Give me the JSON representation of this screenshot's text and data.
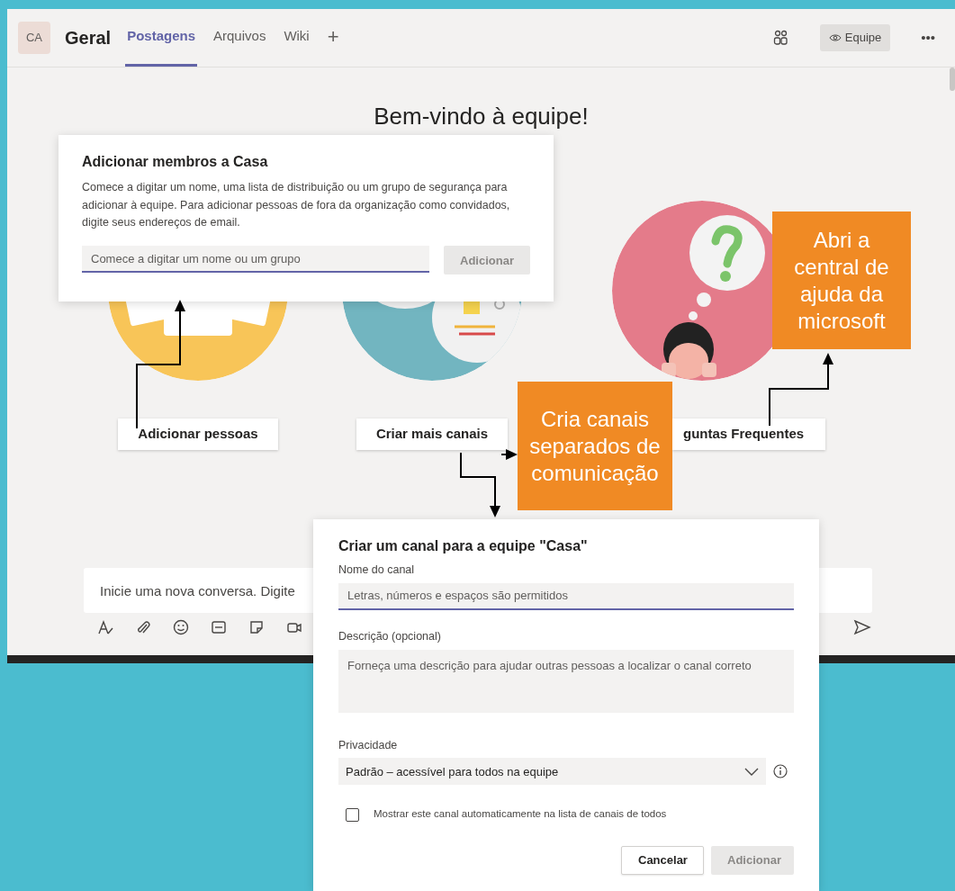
{
  "header": {
    "avatar": "CA",
    "channel": "Geral",
    "add_tab": "+",
    "team_button": "Equipe",
    "more": "•••",
    "tabs": [
      {
        "label": "Postagens",
        "selected": true
      },
      {
        "label": "Arquivos",
        "selected": false
      },
      {
        "label": "Wiki",
        "selected": false
      }
    ]
  },
  "welcome": {
    "title": "Bem-vindo à equipe!",
    "actions": [
      {
        "kind": "people",
        "label": "Adicionar pessoas"
      },
      {
        "kind": "channels",
        "label": "Criar mais canais"
      },
      {
        "kind": "faq",
        "label": "guntas Frequentes"
      }
    ]
  },
  "compose": {
    "placeholder": "Inicie uma nova conversa. Digite"
  },
  "add_members_dialog": {
    "title": "Adicionar membros a Casa",
    "description": "Comece a digitar um nome, uma lista de distribuição ou um grupo de segurança para adicionar à equipe. Para adicionar pessoas de fora da organização como convidados, digite seus endereços de email.",
    "input_placeholder": "Comece a digitar um nome ou um grupo",
    "button": {
      "label": "Adicionar",
      "disabled": true
    }
  },
  "create_channel_dialog": {
    "title": "Criar um canal para a equipe \"Casa\"",
    "name_label": "Nome do canal",
    "name_placeholder": "Letras, números e espaços são permitidos",
    "description_label": "Descrição (opcional)",
    "description_placeholder": "Forneça uma descrição para ajudar outras pessoas a localizar o canal correto",
    "privacy_label": "Privacidade",
    "privacy_value": "Padrão – acessível para todos na equipe",
    "auto_show": {
      "label": "Mostrar este canal automaticamente na lista de canais de todos",
      "checked": false
    },
    "buttons": [
      {
        "label": "Cancelar",
        "disabled": false
      },
      {
        "label": "Adicionar",
        "disabled": true
      }
    ]
  },
  "annotations": [
    {
      "text": "Abri a central de ajuda da microsoft"
    },
    {
      "text": "Cria canais separados de comunicação"
    }
  ]
}
